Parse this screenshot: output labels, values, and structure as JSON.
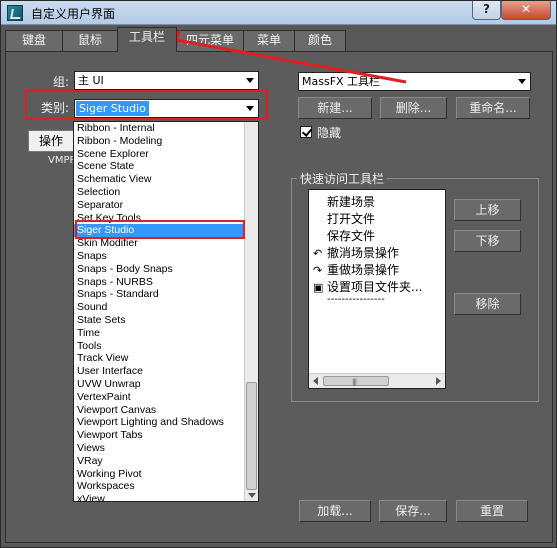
{
  "window": {
    "title": "自定义用户界面",
    "help_label": "?",
    "close_label": "✕"
  },
  "tabs": [
    {
      "label": "键盘"
    },
    {
      "label": "鼠标"
    },
    {
      "label": "工具栏"
    },
    {
      "label": "四元菜单"
    },
    {
      "label": "菜单"
    },
    {
      "label": "颜色"
    }
  ],
  "group": {
    "label": "组:",
    "value": "主 UI"
  },
  "category": {
    "label": "类别:",
    "value": "Siger Studio"
  },
  "actions_button": "操作",
  "vmpp_text": "VMPP",
  "category_list": [
    "Ribbon - Internal",
    "Ribbon - Modeling",
    "Scene Explorer",
    "Scene State",
    "Schematic View",
    "Selection",
    "Separator",
    "Set Key Tools",
    "Siger Studio",
    "Skin Modifier",
    "Snaps",
    "Snaps - Body Snaps",
    "Snaps - NURBS",
    "Snaps - Standard",
    "Sound",
    "State Sets",
    "Time",
    "Tools",
    "Track View",
    "User Interface",
    "UVW Unwrap",
    "VertexPaint",
    "Viewport Canvas",
    "Viewport Lighting and Shadows",
    "Viewport Tabs",
    "Views",
    "VRay",
    "Working Pivot",
    "Workspaces",
    "xView"
  ],
  "selected_category": "Siger Studio",
  "toolbar_select": {
    "value": "MassFX 工具栏"
  },
  "buttons": {
    "new": "新建...",
    "delete": "删除...",
    "rename": "重命名..."
  },
  "hide_checkbox": {
    "label": "隐藏",
    "checked": true
  },
  "quick_access": {
    "title": "快速访问工具栏",
    "items": [
      {
        "icon": "",
        "label": "新建场景"
      },
      {
        "icon": "",
        "label": "打开文件"
      },
      {
        "icon": "",
        "label": "保存文件"
      },
      {
        "icon": "undo-icon",
        "label": "撤消场景操作"
      },
      {
        "icon": "redo-icon",
        "label": "重做场景操作"
      },
      {
        "icon": "project-folder-icon",
        "label": "设置项目文件夹..."
      },
      {
        "icon": "",
        "label": "----------------"
      }
    ],
    "move_up": "上移",
    "move_down": "下移",
    "remove": "移除"
  },
  "footer": {
    "load": "加载...",
    "save": "保存...",
    "reset": "重置"
  },
  "colors": {
    "highlight": "#3399ff",
    "panel": "#5c5c5c",
    "annotation": "#e02020"
  }
}
